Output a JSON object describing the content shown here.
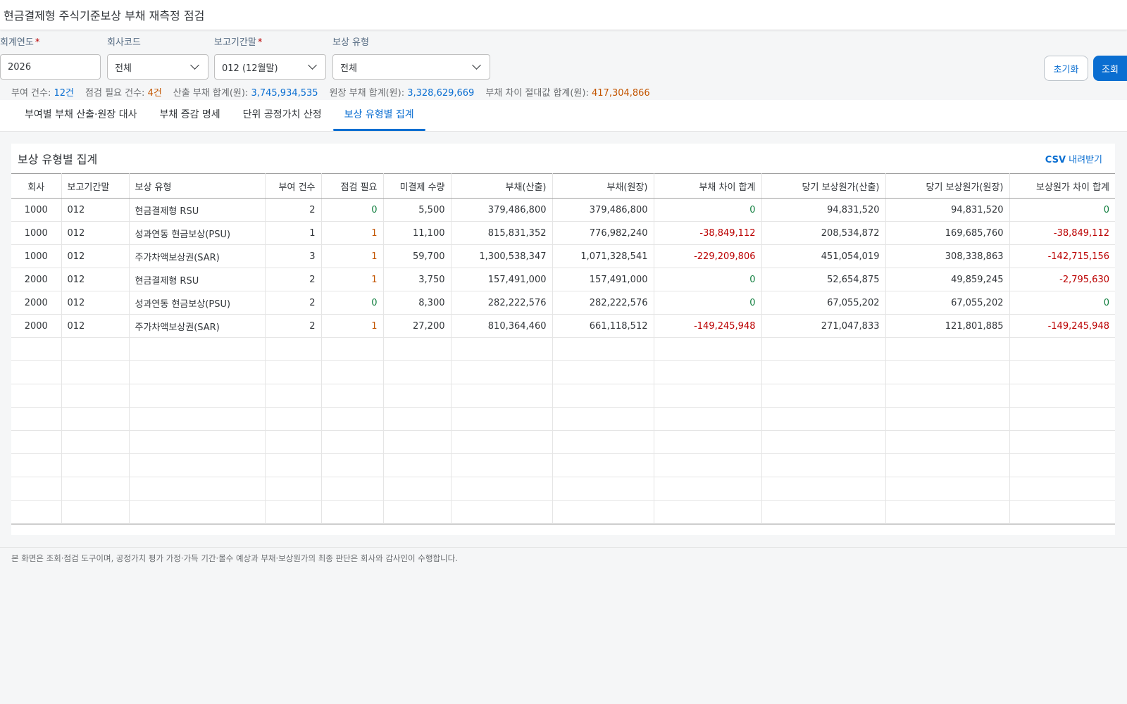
{
  "header": {
    "title": "현금결제형 주식기준보상 부채 재측정 점검"
  },
  "filters": {
    "fiscal_year": {
      "label": "회계연도",
      "value": "2026"
    },
    "company_code": {
      "label": "회사코드",
      "value": "전체"
    },
    "period": {
      "label": "보고기간말",
      "value": "012 (12월말)"
    },
    "comp_type": {
      "label": "보상 유형",
      "value": "전체"
    },
    "reset_label": "초기화",
    "search_label": "조회"
  },
  "summary": {
    "grant_count_label": "부여 건수:",
    "grant_count": "12건",
    "check_count_label": "점검 필요 건수:",
    "check_count": "4건",
    "calc_total_label": "산출 부채 합계(원):",
    "calc_total": "3,745,934,535",
    "ledger_total_label": "원장 부채 합계(원):",
    "ledger_total": "3,328,629,669",
    "diff_abs_label": "부채 차이 절대값 합계(원):",
    "diff_abs": "417,304,866"
  },
  "tabs": [
    {
      "label": "부여별 부채 산출·원장 대사"
    },
    {
      "label": "부채 증감 명세"
    },
    {
      "label": "단위 공정가치 산정"
    },
    {
      "label": "보상 유형별 집계"
    }
  ],
  "panel": {
    "title": "보상 유형별 집계",
    "csv_bold": "CSV",
    "csv_rest": " 내려받기"
  },
  "table": {
    "columns": [
      "회사",
      "보고기간말",
      "보상 유형",
      "부여 건수",
      "점검 필요",
      "미결제 수량",
      "부채(산출)",
      "부채(원장)",
      "부채 차이 합계",
      "당기 보상원가(산출)",
      "당기 보상원가(원장)",
      "보상원가 차이 합계"
    ],
    "rows": [
      {
        "company": "1000",
        "period": "012",
        "type": "현금결제형 RSU",
        "grants": "2",
        "check": "0",
        "qty": "5,500",
        "liab_calc": "379,486,800",
        "liab_ledger": "379,486,800",
        "liab_diff": "0",
        "cost_calc": "94,831,520",
        "cost_ledger": "94,831,520",
        "cost_diff": "0"
      },
      {
        "company": "1000",
        "period": "012",
        "type": "성과연동 현금보상(PSU)",
        "grants": "1",
        "check": "1",
        "qty": "11,100",
        "liab_calc": "815,831,352",
        "liab_ledger": "776,982,240",
        "liab_diff": "-38,849,112",
        "cost_calc": "208,534,872",
        "cost_ledger": "169,685,760",
        "cost_diff": "-38,849,112"
      },
      {
        "company": "1000",
        "period": "012",
        "type": "주가차액보상권(SAR)",
        "grants": "3",
        "check": "1",
        "qty": "59,700",
        "liab_calc": "1,300,538,347",
        "liab_ledger": "1,071,328,541",
        "liab_diff": "-229,209,806",
        "cost_calc": "451,054,019",
        "cost_ledger": "308,338,863",
        "cost_diff": "-142,715,156"
      },
      {
        "company": "2000",
        "period": "012",
        "type": "현금결제형 RSU",
        "grants": "2",
        "check": "1",
        "qty": "3,750",
        "liab_calc": "157,491,000",
        "liab_ledger": "157,491,000",
        "liab_diff": "0",
        "cost_calc": "52,654,875",
        "cost_ledger": "49,859,245",
        "cost_diff": "-2,795,630"
      },
      {
        "company": "2000",
        "period": "012",
        "type": "성과연동 현금보상(PSU)",
        "grants": "2",
        "check": "0",
        "qty": "8,300",
        "liab_calc": "282,222,576",
        "liab_ledger": "282,222,576",
        "liab_diff": "0",
        "cost_calc": "67,055,202",
        "cost_ledger": "67,055,202",
        "cost_diff": "0"
      },
      {
        "company": "2000",
        "period": "012",
        "type": "주가차액보상권(SAR)",
        "grants": "2",
        "check": "1",
        "qty": "27,200",
        "liab_calc": "810,364,460",
        "liab_ledger": "661,118,512",
        "liab_diff": "-149,245,948",
        "cost_calc": "271,047,833",
        "cost_ledger": "121,801,885",
        "cost_diff": "-149,245,948"
      }
    ]
  },
  "footer": {
    "note": "본 화면은 조회·점검 도구이며, 공정가치 평가 가정·가득 기간·몰수 예상과 부채·보상원가의 최종 판단은 회사와 감사인이 수행합니다."
  }
}
